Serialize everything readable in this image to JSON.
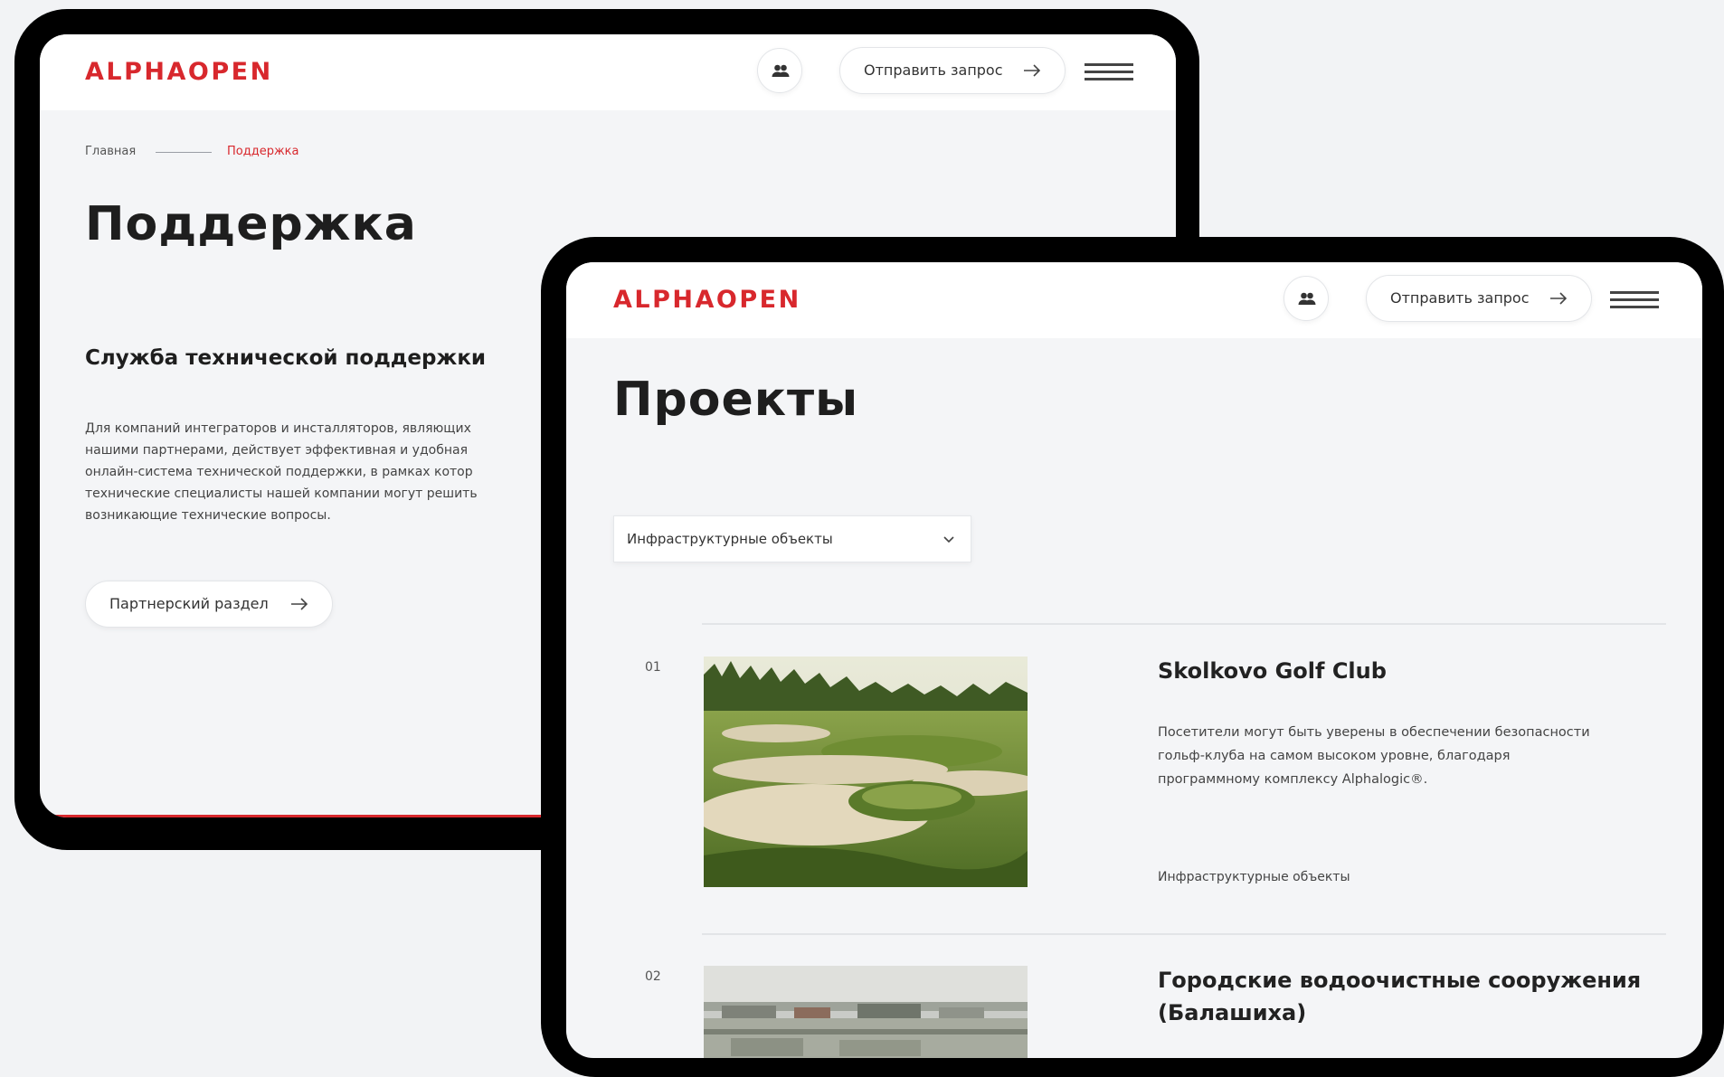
{
  "back_screen": {
    "header": {
      "logo": "ALPHAOPEN",
      "request_button": "Отправить запрос"
    },
    "breadcrumb": {
      "home": "Главная",
      "current": "Поддержка"
    },
    "page_title": "Поддержка",
    "section_title": "Служба технической поддержки",
    "paragraph_lines": [
      "Для компаний интеграторов и инсталляторов, являющих",
      "нашими партнерами, действует эффективная и удобная",
      "онлайн-система технической поддержки, в рамках котор",
      "технические специалисты нашей компании могут решить",
      "возникающие технические вопросы."
    ],
    "partner_button": "Партнерский раздел"
  },
  "front_screen": {
    "header": {
      "logo": "ALPHAOPEN",
      "request_button": "Отправить запрос"
    },
    "page_title": "Проекты",
    "filter": {
      "selected": "Инфраструктурные объекты"
    },
    "projects": [
      {
        "number": "01",
        "title": "Skolkovo Golf Club",
        "description_lines": [
          "Посетители могут быть уверены в обеспечении безопасности",
          "гольф-клуба на самом высоком уровне, благодаря",
          "программному комплексу Alphalogic®."
        ],
        "category": "Инфраструктурные объекты"
      },
      {
        "number": "02",
        "title_lines": [
          "Городские водоочистные сооружения",
          "(Балашиха)"
        ]
      }
    ]
  },
  "colors": {
    "brand_red": "#d8282d",
    "device_frame": "#000000",
    "page_bg": "#f4f5f7"
  }
}
